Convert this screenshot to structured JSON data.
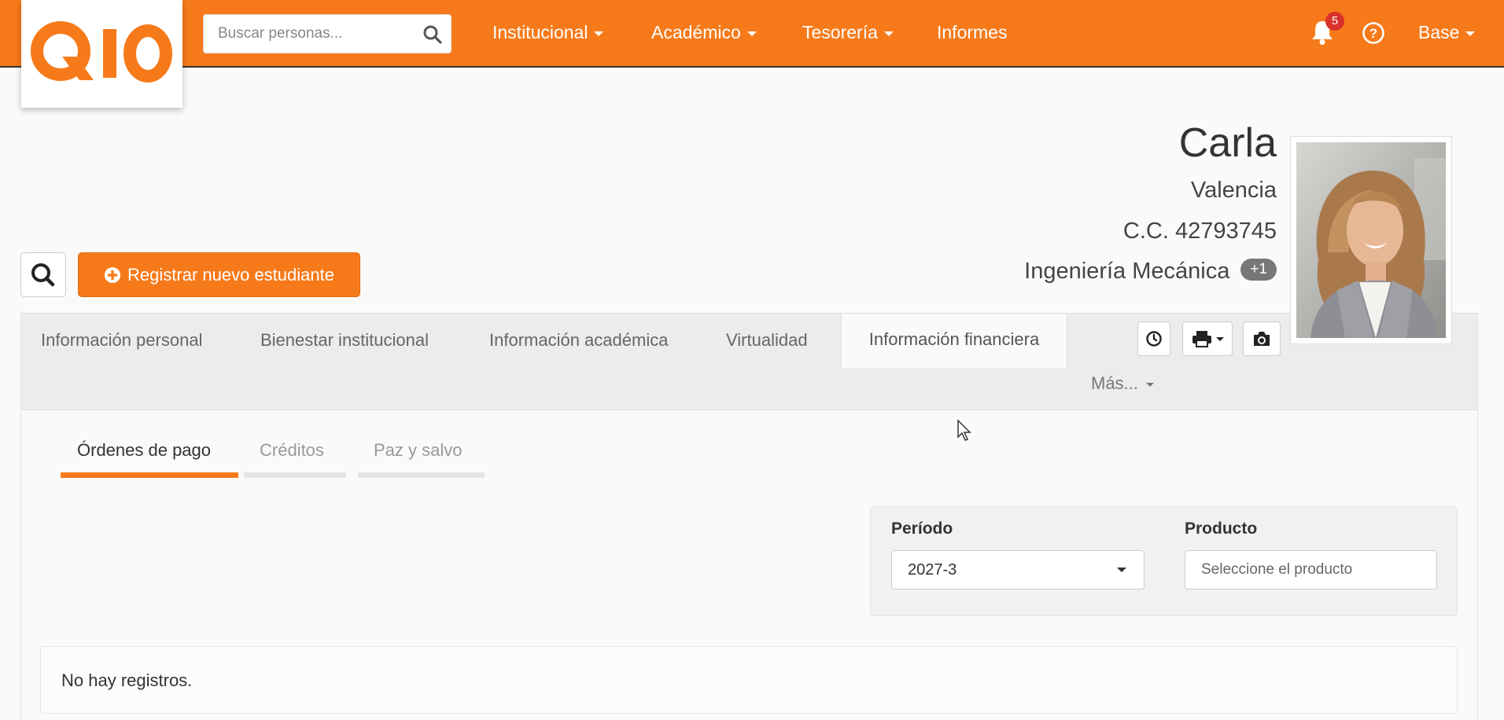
{
  "brand": {
    "logo_text": "Q10",
    "accent_color": "#f77a1a"
  },
  "search": {
    "placeholder": "Buscar personas..."
  },
  "nav": {
    "items": [
      {
        "label": "Institucional",
        "has_dropdown": true
      },
      {
        "label": "Académico",
        "has_dropdown": true
      },
      {
        "label": "Tesorería",
        "has_dropdown": true
      },
      {
        "label": "Informes",
        "has_dropdown": false
      }
    ],
    "notifications_count": "5",
    "user_label": "Base"
  },
  "profile": {
    "first_name": "Carla",
    "last_name": "Valencia",
    "document": "C.C. 42793745",
    "program": "Ingeniería Mecánica",
    "extra_programs_badge": "+1"
  },
  "actions": {
    "register_label": "Registrar nuevo estudiante"
  },
  "tabs": {
    "items": [
      {
        "label": "Información personal"
      },
      {
        "label": "Bienestar institucional"
      },
      {
        "label": "Información académica"
      },
      {
        "label": "Virtualidad"
      },
      {
        "label": "Información financiera",
        "active": true
      }
    ],
    "more_label": "Más..."
  },
  "subtabs": {
    "items": [
      {
        "label": "Órdenes de pago",
        "active": true
      },
      {
        "label": "Créditos"
      },
      {
        "label": "Paz y salvo"
      }
    ]
  },
  "filters": {
    "periodo_label": "Período",
    "periodo_value": "2027-3",
    "producto_label": "Producto",
    "producto_placeholder": "Seleccione el producto"
  },
  "results": {
    "empty_text": "No hay registros."
  },
  "icons": {
    "search": "search-icon",
    "bell": "bell-icon",
    "help": "help-circle-icon",
    "plus_circle": "plus-circle-icon",
    "history": "clock-icon",
    "print": "print-icon",
    "camera": "camera-icon"
  }
}
